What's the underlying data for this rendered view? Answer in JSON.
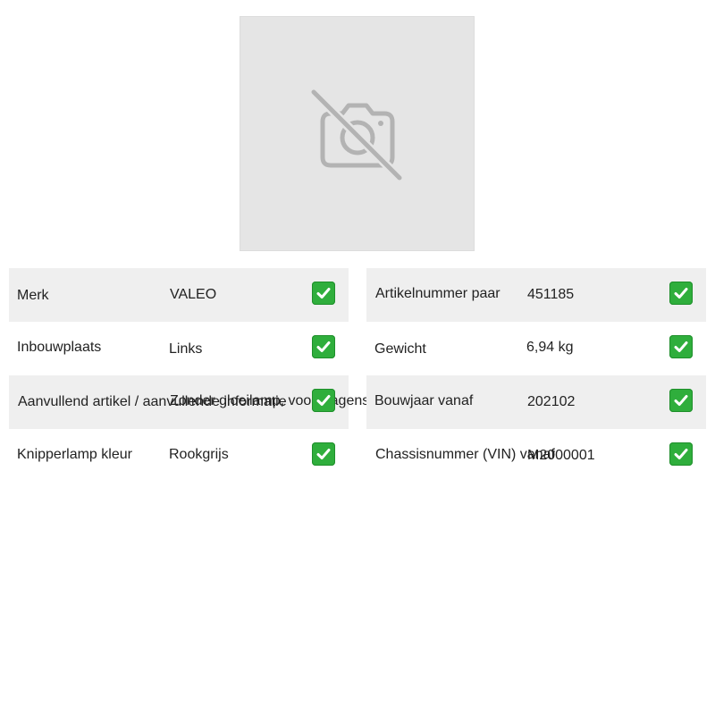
{
  "product": {
    "image_icon": "camera-off-icon"
  },
  "specs_left": [
    {
      "label": "Merk",
      "value": "VALEO",
      "status_icon": "check-icon"
    },
    {
      "label": "Inbouwplaats",
      "value": "Links",
      "status_icon": "check-icon"
    },
    {
      "label": "Aanvullend artikel / aanvullende informatie",
      "value": "Zonder gloeilamp, voor wagens",
      "status_icon": "check-icon"
    },
    {
      "label": "Knipperlamp kleur",
      "value": "Rookgrijs",
      "status_icon": "check-icon"
    }
  ],
  "specs_right": [
    {
      "label": "Artikelnummer paar",
      "value": "451185",
      "status_icon": "check-icon"
    },
    {
      "label": "Gewicht",
      "value": "6,94 kg",
      "status_icon": "check-icon"
    },
    {
      "label": "Bouwjaar vanaf",
      "value": "202102",
      "status_icon": "check-icon"
    },
    {
      "label": "Chassisnummer (VIN) vanaf",
      "value": "M2000001",
      "status_icon": "check-icon"
    }
  ],
  "colors": {
    "row_shade": "#efefef",
    "check_green": "#2fae3c",
    "placeholder_bg": "#e5e5e5"
  }
}
